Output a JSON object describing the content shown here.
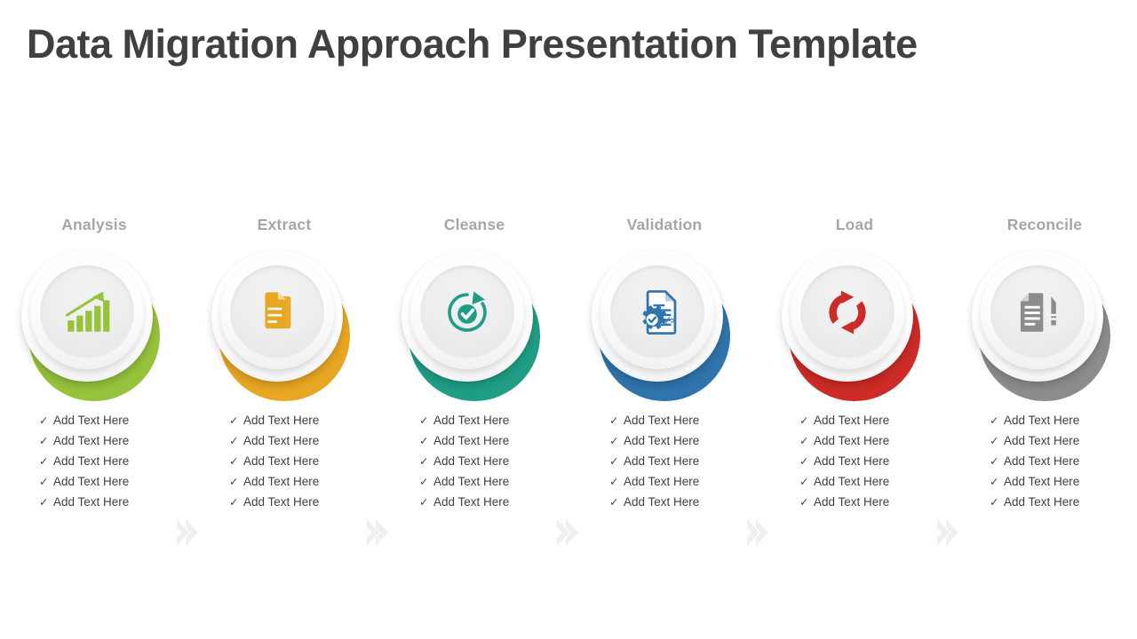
{
  "slide": {
    "title": "Data Migration Approach Presentation Template",
    "title_color": "#404040",
    "background": "#ffffff",
    "label_color": "#a6a6a6",
    "chevron_color": "#efefef",
    "bullet_symbol": "✓"
  },
  "steps": [
    {
      "label": "Analysis",
      "color": "#96c23c",
      "icon": "bar-chart-growth-icon",
      "bullets": [
        "Add Text Here",
        "Add Text Here",
        "Add Text Here",
        "Add Text Here",
        "Add Text Here"
      ]
    },
    {
      "label": "Extract",
      "color": "#e8a723",
      "icon": "stacked-documents-icon",
      "bullets": [
        "Add Text Here",
        "Add Text Here",
        "Add Text Here",
        "Add Text Here",
        "Add Text Here"
      ]
    },
    {
      "label": "Cleanse",
      "color": "#1f9e85",
      "icon": "refresh-check-icon",
      "bullets": [
        "Add Text Here",
        "Add Text Here",
        "Add Text Here",
        "Add Text Here",
        "Add Text Here"
      ]
    },
    {
      "label": "Validation",
      "color": "#2f74ad",
      "icon": "document-gear-code-icon",
      "bullets": [
        "Add Text Here",
        "Add Text Here",
        "Add Text Here",
        "Add Text Here",
        "Add Text Here"
      ]
    },
    {
      "label": "Load",
      "color": "#cc2b27",
      "icon": "sync-arrows-icon",
      "bullets": [
        "Add Text Here",
        "Add Text Here",
        "Add Text Here",
        "Add Text Here",
        "Add Text Here"
      ]
    },
    {
      "label": "Reconcile",
      "color": "#8c8c8c",
      "icon": "document-pencil-icon",
      "bullets": [
        "Add Text Here",
        "Add Text Here",
        "Add Text Here",
        "Add Text Here",
        "Add Text Here"
      ]
    }
  ],
  "separators": [
    {
      "icon": "chevron-right-icon"
    },
    {
      "icon": "chevron-right-icon"
    },
    {
      "icon": "chevron-right-icon"
    },
    {
      "icon": "chevron-right-icon"
    },
    {
      "icon": "chevron-right-icon"
    }
  ]
}
